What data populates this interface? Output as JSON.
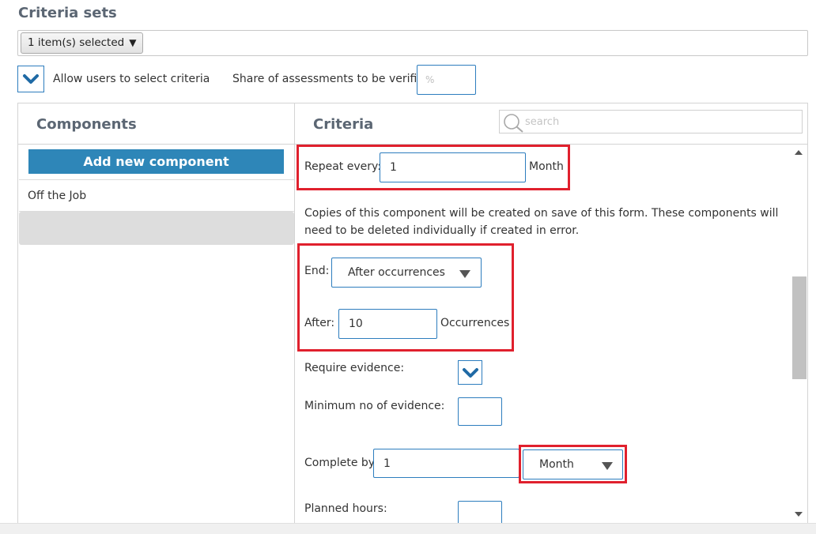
{
  "criteria_sets": {
    "title": "Criteria sets",
    "selected_label": "1 item(s) selected",
    "caret": "▼"
  },
  "options": {
    "allow_select_label": "Allow users to select criteria",
    "allow_select_checked": true,
    "share_label": "Share of assessments to be verified",
    "share_placeholder": "%",
    "share_value": ""
  },
  "components": {
    "header": "Components",
    "add_button_label": "Add new component",
    "items": [
      {
        "label": "Off the Job"
      },
      {
        "label": ""
      }
    ]
  },
  "criteria": {
    "header": "Criteria",
    "search_placeholder": "search",
    "repeat_label": "Repeat every:",
    "repeat_value": "1",
    "repeat_unit": "Month",
    "copies_note": "Copies of this component will be created on save of this form. These components will need to be deleted individually if created in error.",
    "end_label": "End:",
    "end_selected": "After occurrences",
    "after_label": "After:",
    "after_value": "10",
    "after_unit": "Occurrences",
    "require_evidence_label": "Require evidence:",
    "require_evidence_checked": true,
    "min_evidence_label": "Minimum no of evidence:",
    "min_evidence_value": "",
    "complete_by_label": "Complete by",
    "complete_by_value": "1",
    "complete_by_unit": "Month",
    "planned_hours_label": "Planned hours:",
    "planned_hours_value": ""
  },
  "colors": {
    "accent": "#2d7dbe",
    "button": "#2e86b8",
    "highlight": "#e0202d",
    "heading": "#5b6673"
  },
  "icons": {
    "checkbox_check": "check-chevron-icon",
    "search": "search-icon",
    "dropdown": "triangle-down-icon"
  }
}
